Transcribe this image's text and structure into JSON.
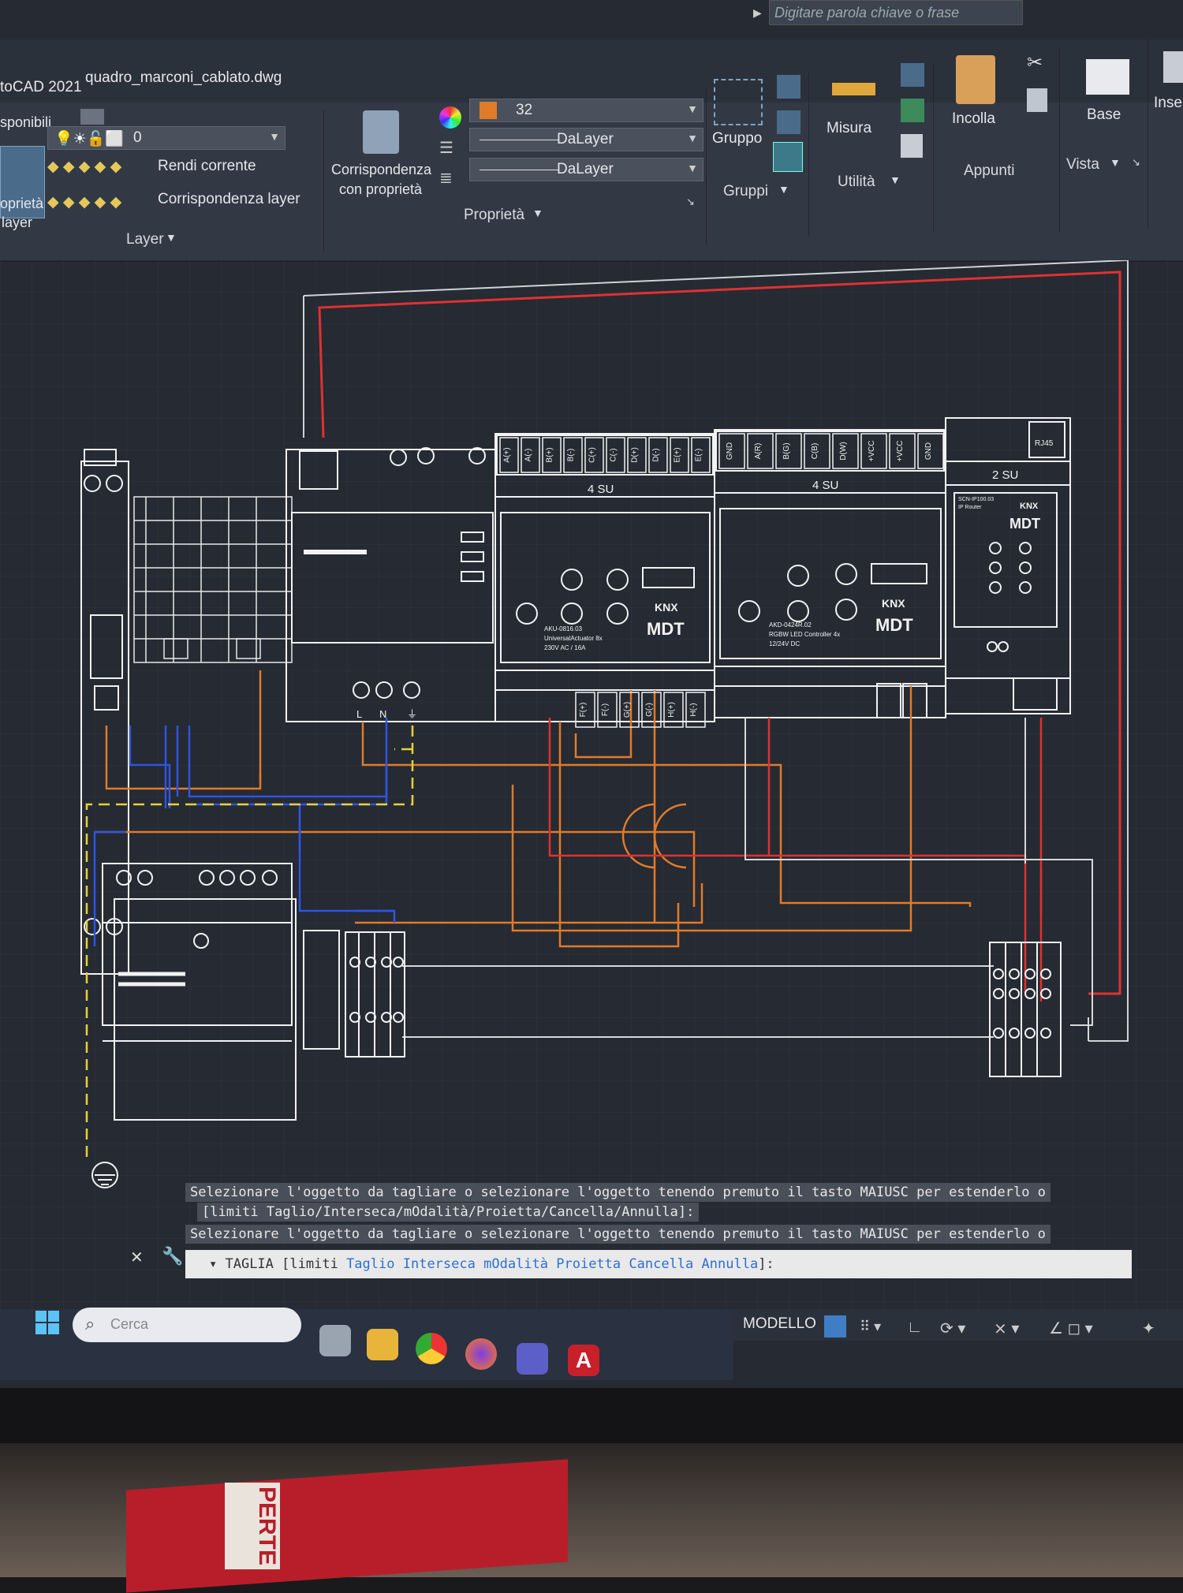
{
  "app": {
    "title": "toCAD 2021",
    "file": "quadro_marconi_cablato.dwg"
  },
  "search": {
    "placeholder": "Digitare parola chiave o frase"
  },
  "ribbon": {
    "left_partial": "sponibili",
    "props_layer_line1": "oprietà",
    "props_layer_line2": "layer",
    "layer_value": "0",
    "rendi_corrente": "Rendi corrente",
    "corrispondenza_layer": "Corrispondenza layer",
    "layer_group": "Layer",
    "corrispondenza_line1": "Corrispondenza",
    "corrispondenza_line2": "con proprietà",
    "color_value": "32",
    "linetype_value": "DaLayer",
    "lineweight_value": "DaLayer",
    "properties_group": "Proprietà",
    "gruppo": "Gruppo",
    "gruppi_group": "Gruppi",
    "misura": "Misura",
    "utilita_group": "Utilità",
    "incolla": "Incolla",
    "appunti_group": "Appunti",
    "base": "Base",
    "vista_group": "Vista",
    "inse_partial": "Inse"
  },
  "colors": {
    "red": "#e03131",
    "orange": "#e07b2a",
    "blue": "#2f55e0",
    "yellow": "#e5d23a",
    "white_line": "#f2f2f2",
    "grid": "#2f3642",
    "bg": "#252a33"
  },
  "modules": {
    "actuator1": {
      "units": "4 SU",
      "terminals": [
        "A(+)",
        "A(-)",
        "B(+)",
        "B(-)",
        "C(+)",
        "C(-)",
        "D(+)",
        "D(-)",
        "E(+)",
        "E(-)"
      ],
      "bottom_terminals": [
        "F(+)",
        "F(-)",
        "G(+)",
        "G(-)",
        "H(+)",
        "H(-)"
      ],
      "brand": "KNX",
      "maker": "MDT",
      "model": "AKU-0816.03",
      "desc1": "UniversalActuator 8x",
      "desc2": "230V AC / 16A"
    },
    "actuator2": {
      "units": "4 SU",
      "terminals": [
        "GND",
        "A(R)",
        "B(G)",
        "C(B)",
        "D(W)",
        "+VCC",
        "+VCC",
        "GND"
      ],
      "brand": "KNX",
      "maker": "MDT",
      "model": "AKD-0424R.02",
      "desc1": "RGBW LED Controller 4x",
      "desc2": "12/24V DC"
    },
    "router": {
      "units": "2 SU",
      "terminal": "RJ45",
      "model": "SCN-IP100.03",
      "desc": "IP Router",
      "brand": "KNX",
      "maker": "MDT"
    },
    "psu": {
      "labels": [
        "L",
        "N",
        "⏚"
      ]
    }
  },
  "command": {
    "history1a": "Selezionare l'oggetto da tagliare o selezionare l'oggetto tenendo premuto il tasto MAIUSC per estenderlo o",
    "history1b": "[limiti Taglio/Interseca/mOdalità/Proietta/Cancella/Annulla]:",
    "history2": "Selezionare l'oggetto da tagliare o selezionare l'oggetto tenendo premuto il tasto MAIUSC per estenderlo o",
    "prompt_cmd": "TAGLIA",
    "prompt_open": "[limiti",
    "opt_taglio": "Taglio",
    "opt_interseca": "Interseca",
    "opt_modalita": "mOdalità",
    "opt_proietta": "Proietta",
    "opt_cancella": "Cancella",
    "opt_annulla": "Annulla",
    "prompt_close": "]:"
  },
  "status": {
    "modello": "MODELLO"
  },
  "taskbar": {
    "search_label": "Cerca"
  },
  "box_text": "PERTE"
}
